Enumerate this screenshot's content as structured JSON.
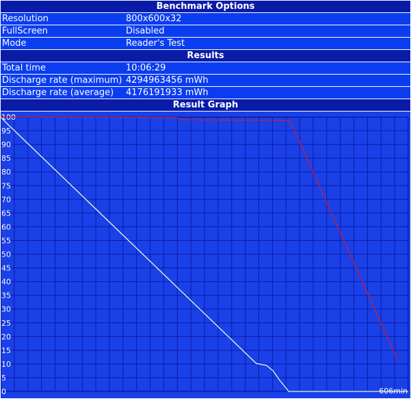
{
  "benchmark": {
    "title": "Benchmark Options",
    "rows": [
      {
        "label": "Resolution",
        "value": "800x600x32"
      },
      {
        "label": "FullScreen",
        "value": "Disabled"
      },
      {
        "label": "Mode",
        "value": "Reader's Test"
      }
    ]
  },
  "results": {
    "title": "Results",
    "rows": [
      {
        "label": "Total time",
        "value": "10:06:29"
      },
      {
        "label": "Discharge rate (maximum)",
        "value": "4294963456 mWh"
      },
      {
        "label": "Discharge rate (average)",
        "value": "4176191933 mWh"
      }
    ]
  },
  "graph": {
    "title": "Result Graph"
  },
  "colors": {
    "header_bg": "#0a1ba8",
    "row_bg": "#0b3df0",
    "plot_bg": "#1a40e8",
    "grid": "#0a1ba8",
    "battery_line": "#e8ffe0",
    "second_line": "#c0203a"
  },
  "chart_data": {
    "type": "line",
    "title": "Result Graph",
    "xlim": [
      0,
      606
    ],
    "ylim": [
      0,
      100
    ],
    "yticks": [
      100,
      95,
      90,
      85,
      80,
      75,
      70,
      65,
      60,
      55,
      50,
      45,
      40,
      35,
      30,
      25,
      20,
      15,
      10,
      5,
      0
    ],
    "x_end_label": "606min",
    "grid": true,
    "series": [
      {
        "color": "#e8ffe0",
        "points": [
          [
            0,
            100
          ],
          [
            10,
            97.5
          ],
          [
            380,
            10.2
          ],
          [
            395,
            9.5
          ],
          [
            405,
            7.5
          ],
          [
            415,
            4
          ],
          [
            425,
            1
          ],
          [
            428,
            0
          ],
          [
            606,
            0
          ]
        ]
      },
      {
        "color": "#c0203a",
        "points": [
          [
            0,
            100
          ],
          [
            260,
            99.8
          ],
          [
            270,
            99.0
          ],
          [
            430,
            98.7
          ],
          [
            590,
            11.5
          ]
        ]
      }
    ]
  }
}
